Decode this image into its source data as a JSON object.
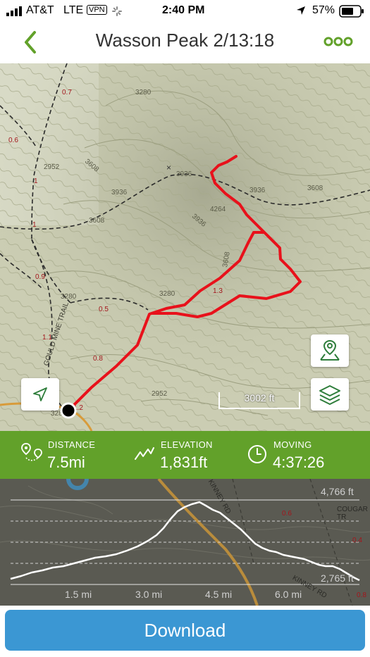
{
  "status_bar": {
    "carrier": "AT&T",
    "network": "LTE",
    "vpn": "VPN",
    "time": "2:40 PM",
    "battery": "57%"
  },
  "nav": {
    "title": "Wasson Peak 2/13:18",
    "back_icon": "chevron-left-icon",
    "more_icon": "more-dots-icon",
    "accent_color": "#62a12a"
  },
  "map": {
    "contour_labels": [
      "3280",
      "3608",
      "3936",
      "3936",
      "4264",
      "3936",
      "3608",
      "3608",
      "3280",
      "2952",
      "3280",
      "3608",
      "2952",
      "3280",
      "3936"
    ],
    "trail_labels": [
      "0.7",
      "1",
      "1",
      "0.9",
      "0.5",
      "1.1",
      "0.8",
      "1.3",
      "1.2",
      "0.6"
    ],
    "trail_name": "GOULD MINE TRAIL",
    "scale_label": "3002 ft",
    "route_color": "#e8111b"
  },
  "stats": {
    "distance": {
      "label": "DISTANCE",
      "value": "7.5mi"
    },
    "elevation": {
      "label": "ELEVATION",
      "value": "1,831ft"
    },
    "moving": {
      "label": "MOVING",
      "value": "4:37:26"
    }
  },
  "elevation_chart": {
    "max_label": "4,766 ft",
    "min_label": "2,765 ft",
    "x_labels": [
      "1.5 mi",
      "3.0 mi",
      "4.5 mi",
      "6.0 mi"
    ],
    "road_labels": [
      "KINNEY RD",
      "COUGAR TR",
      "KINNEY RD",
      "0.6",
      "0.4",
      "0.8"
    ]
  },
  "footer": {
    "download_label": "Download"
  }
}
